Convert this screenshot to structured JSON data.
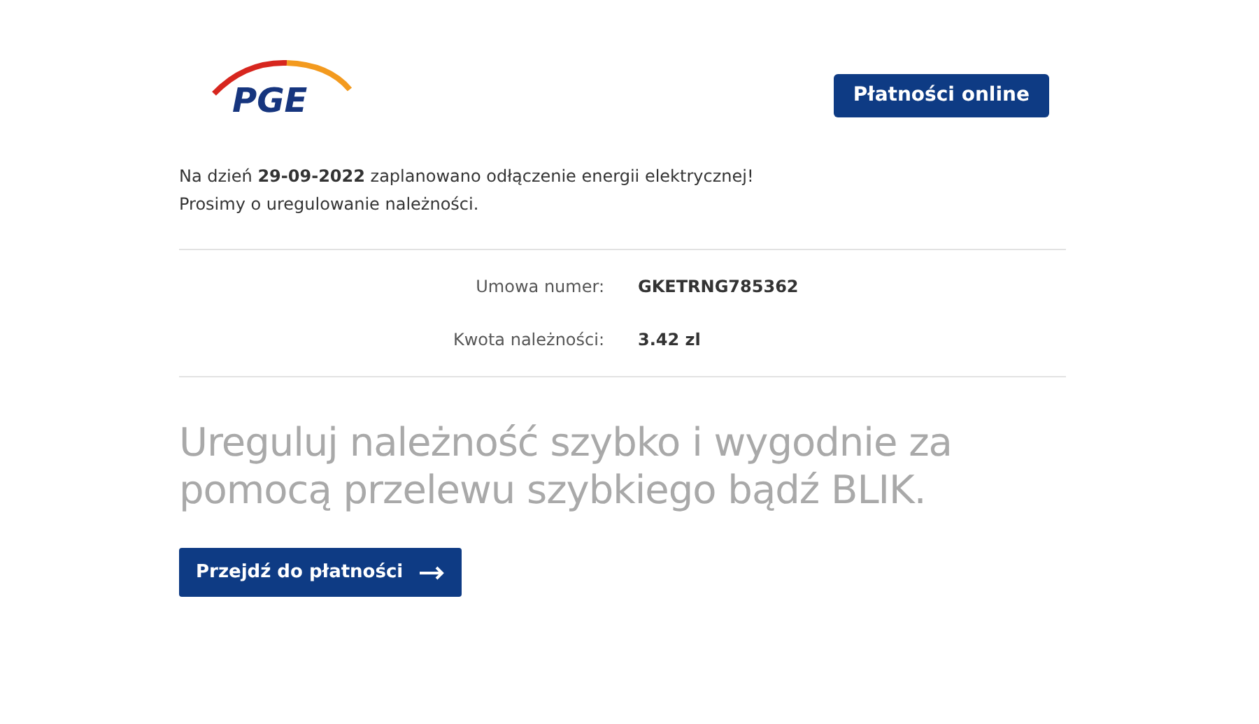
{
  "logo": {
    "text": "PGE"
  },
  "header_button": "Płatności online",
  "notice": [
    "Na dzień **29-09-2022** zaplanowano odłączenie energii elektrycznej!",
    "Prosimy o uregulowanie należności."
  ],
  "details": [
    {
      "label": "Umowa numer:",
      "value": "GKETRNG785362"
    },
    {
      "label": "Kwota należności:",
      "value": "3.42 zl"
    }
  ],
  "headline": [
    "Ureguluj należność szybko i wygodnie za",
    "pomocą przelewu szybkiego bądź BLIK."
  ],
  "pay_button": "Przejdź do płatności"
}
